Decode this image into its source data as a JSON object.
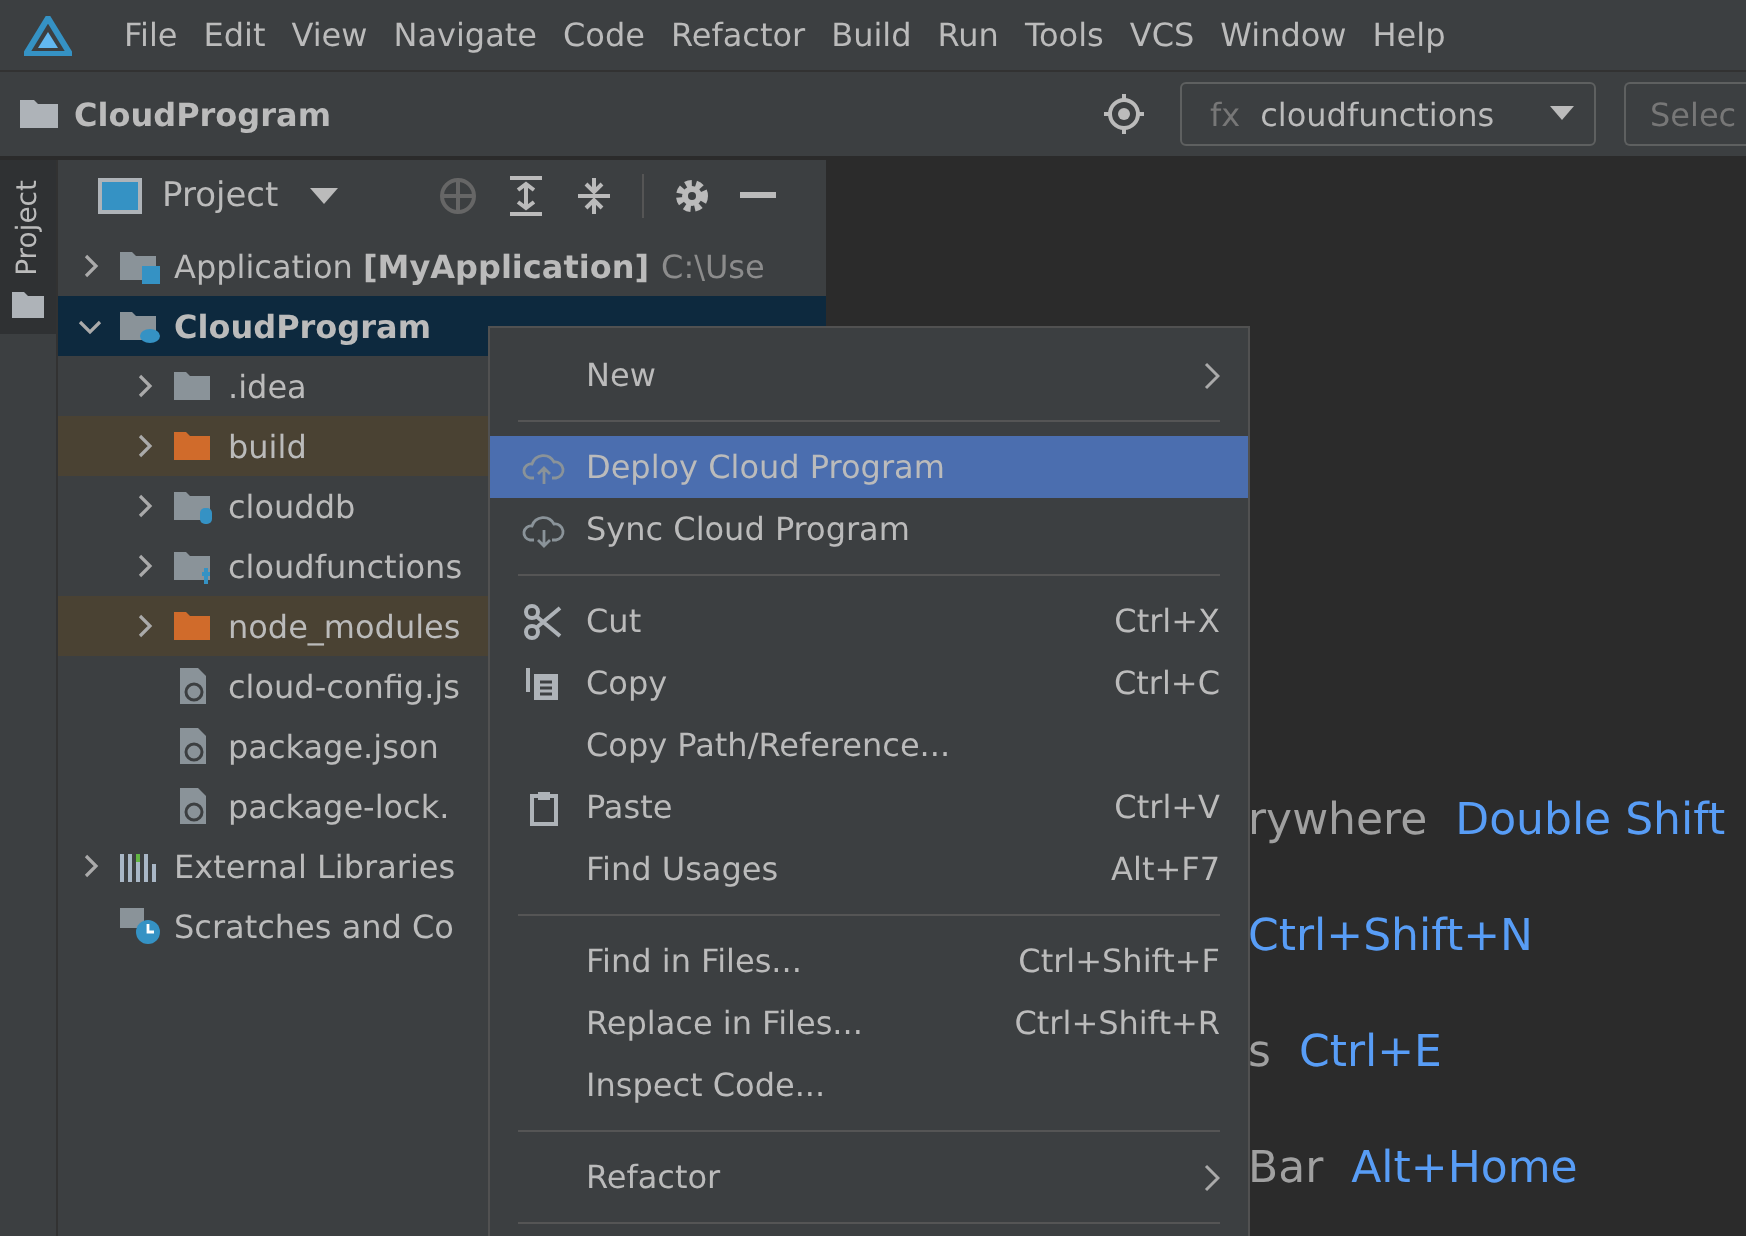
{
  "menu_bar": [
    "File",
    "Edit",
    "View",
    "Navigate",
    "Code",
    "Refactor",
    "Build",
    "Run",
    "Tools",
    "VCS",
    "Window",
    "Help"
  ],
  "nav_bar": {
    "project": "CloudProgram",
    "config_prefix": "fx",
    "config": "cloudfunctions",
    "next_field": "Selec"
  },
  "side_stripe": [
    {
      "label": "Project",
      "selected": true
    }
  ],
  "project_panel": {
    "title": "Project",
    "tree": [
      {
        "kind": "module",
        "label": "Application **[MyApplication]**",
        "path": "C:\\Use",
        "expanded": false,
        "selected": false,
        "excluded": false
      },
      {
        "kind": "cloud-module",
        "label": "**CloudProgram**",
        "expanded": true,
        "selected": true,
        "excluded": false,
        "children": [
          {
            "kind": "folder",
            "label": ".idea",
            "expanded": false,
            "selected": false,
            "excluded": false
          },
          {
            "kind": "excluded-folder",
            "label": "build",
            "expanded": false,
            "selected": false,
            "excluded": true
          },
          {
            "kind": "db-folder",
            "label": "clouddb",
            "expanded": false,
            "selected": false,
            "excluded": false
          },
          {
            "kind": "function-folder",
            "label": "cloudfunctions",
            "expanded": false,
            "selected": false,
            "excluded": false
          },
          {
            "kind": "excluded-folder",
            "label": "node_modules",
            "expanded": false,
            "selected": false,
            "excluded": true
          },
          {
            "kind": "json-file",
            "label": "cloud-config.js",
            "selected": false,
            "excluded": false
          },
          {
            "kind": "json-file",
            "label": "package.json",
            "selected": false,
            "excluded": false
          },
          {
            "kind": "json-file",
            "label": "package-lock.",
            "selected": false,
            "excluded": false
          }
        ]
      },
      {
        "kind": "libraries",
        "label": "External Libraries",
        "expanded": false,
        "selected": false,
        "excluded": false
      },
      {
        "kind": "scratches",
        "label": "Scratches and Co",
        "selected": false,
        "excluded": false
      }
    ]
  },
  "editor_hints": [
    {
      "label": "rywhere",
      "shortcut": "Double Shift"
    },
    {
      "shortcut": "Ctrl+Shift+N"
    },
    {
      "label": "s",
      "shortcut": "Ctrl+E"
    },
    {
      "label": "Bar",
      "shortcut": "Alt+Home"
    }
  ],
  "context_menu": [
    {
      "kind": "item",
      "label": "New",
      "submenu": true,
      "selected": false
    },
    {
      "kind": "separator"
    },
    {
      "kind": "cloud-upload",
      "label": "Deploy Cloud Program",
      "selected": true
    },
    {
      "kind": "cloud-download",
      "label": "Sync Cloud Program",
      "selected": false
    },
    {
      "kind": "separator"
    },
    {
      "kind": "scissors",
      "label": "Cut",
      "shortcut": "Ctrl+X",
      "selected": false
    },
    {
      "kind": "copy",
      "label": "Copy",
      "shortcut": "Ctrl+C",
      "selected": false
    },
    {
      "kind": "item",
      "label": "Copy Path/Reference...",
      "selected": false
    },
    {
      "kind": "clipboard",
      "label": "Paste",
      "shortcut": "Ctrl+V",
      "selected": false
    },
    {
      "kind": "item",
      "label": "Find Usages",
      "shortcut": "Alt+F7",
      "selected": false
    },
    {
      "kind": "separator"
    },
    {
      "kind": "item",
      "label": "Find in Files...",
      "shortcut": "Ctrl+Shift+F",
      "selected": false
    },
    {
      "kind": "item",
      "label": "Replace in Files...",
      "shortcut": "Ctrl+Shift+R",
      "selected": false
    },
    {
      "kind": "item",
      "label": "Inspect Code...",
      "selected": false
    },
    {
      "kind": "separator"
    },
    {
      "kind": "item",
      "label": "Refactor",
      "submenu": true,
      "selected": false
    },
    {
      "kind": "separator"
    }
  ]
}
